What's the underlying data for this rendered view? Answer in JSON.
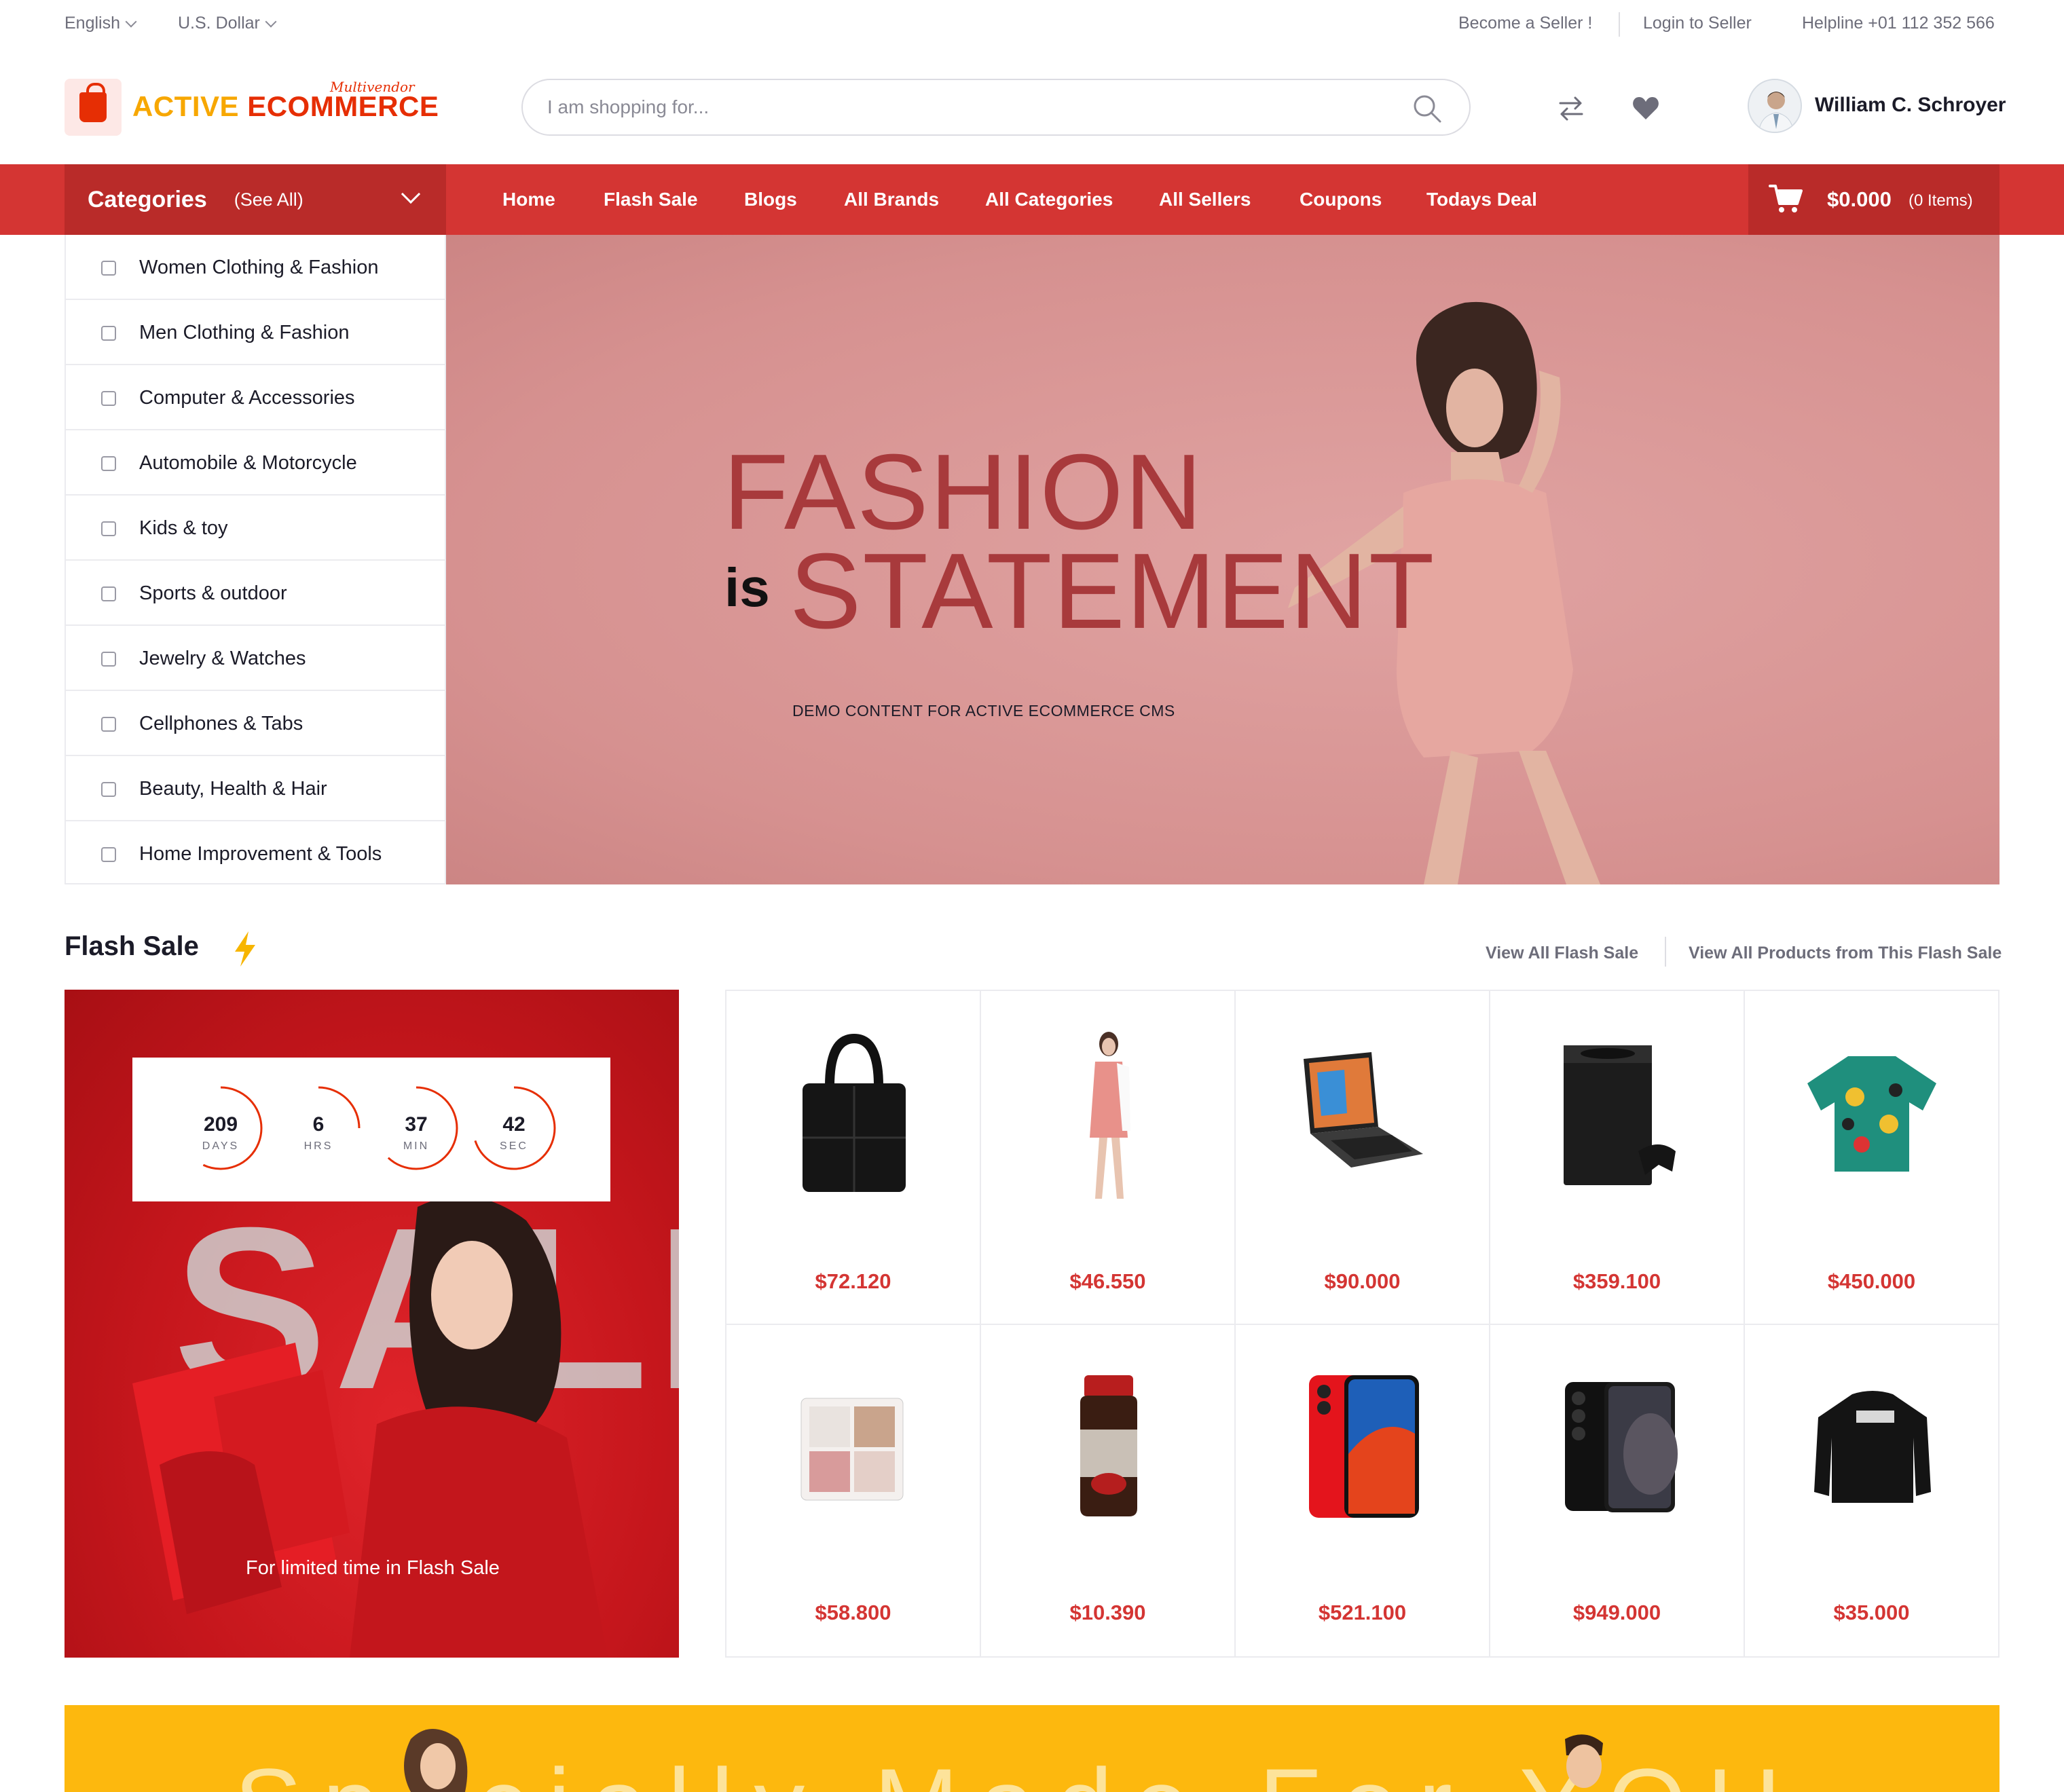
{
  "topbar": {
    "language": "English",
    "currency": "U.S. Dollar",
    "become_seller": "Become a Seller !",
    "login_seller": "Login to Seller",
    "helpline": "Helpline +01 112 352 566"
  },
  "header": {
    "logo_part1": "ACTIVE",
    "logo_part2": "ECOMMERCE",
    "logo_tagline": "Multivendor",
    "search_placeholder": "I am shopping for...",
    "user_name": "William C. Schroyer"
  },
  "nav": {
    "categories_title": "Categories",
    "see_all": "(See All)",
    "links": [
      "Home",
      "Flash Sale",
      "Blogs",
      "All Brands",
      "All Categories",
      "All Sellers",
      "Coupons",
      "Todays Deal"
    ],
    "cart_amount": "$0.000",
    "cart_items": "(0 Items)"
  },
  "categories": [
    {
      "label": "Women Clothing & Fashion",
      "icon": "dress-icon"
    },
    {
      "label": "Men Clothing & Fashion",
      "icon": "shirt-icon"
    },
    {
      "label": "Computer & Accessories",
      "icon": "computer-icon"
    },
    {
      "label": "Automobile & Motorcycle",
      "icon": "car-icon"
    },
    {
      "label": "Kids & toy",
      "icon": "toy-icon"
    },
    {
      "label": "Sports & outdoor",
      "icon": "sports-icon"
    },
    {
      "label": "Jewelry & Watches",
      "icon": "watch-icon"
    },
    {
      "label": "Cellphones & Tabs",
      "icon": "phone-icon"
    },
    {
      "label": "Beauty, Health & Hair",
      "icon": "beauty-icon"
    },
    {
      "label": "Home Improvement & Tools",
      "icon": "tools-icon"
    }
  ],
  "hero": {
    "line1": "FASHION",
    "line2_prefix": "is",
    "line2": "STATEMENT",
    "subtitle": "DEMO CONTENT FOR ACTIVE ECOMMERCE CMS"
  },
  "flash_sale": {
    "title": "Flash Sale",
    "view_all": "View All Flash Sale",
    "view_products": "View All Products from This Flash Sale",
    "banner_word": "SALE",
    "caption": "For limited time in Flash Sale",
    "countdown": [
      {
        "value": "209",
        "label": "DAYS",
        "fraction": 0.57
      },
      {
        "value": "6",
        "label": "HRS",
        "fraction": 0.25
      },
      {
        "value": "37",
        "label": "MIN",
        "fraction": 0.62
      },
      {
        "value": "42",
        "label": "SEC",
        "fraction": 0.7
      }
    ],
    "products": [
      {
        "price": "$72.120",
        "image": "black-tote-bag"
      },
      {
        "price": "$46.550",
        "image": "pink-dress-model"
      },
      {
        "price": "$90.000",
        "image": "tablet-keyboard"
      },
      {
        "price": "$359.100",
        "image": "game-console"
      },
      {
        "price": "$450.000",
        "image": "printed-shirt"
      },
      {
        "price": "$58.800",
        "image": "eyeshadow-palette"
      },
      {
        "price": "$10.390",
        "image": "coffee-jar"
      },
      {
        "price": "$521.100",
        "image": "red-iphone"
      },
      {
        "price": "$949.000",
        "image": "black-smartphone"
      },
      {
        "price": "$35.000",
        "image": "black-hoodie"
      }
    ]
  },
  "promo_banner": {
    "text": "Specially Made For YOU",
    "bg_color": "#fdb80e"
  },
  "colors": {
    "brand_red": "#d43533",
    "brand_dark_red": "#b92b29",
    "brand_orange": "#f7a700"
  }
}
